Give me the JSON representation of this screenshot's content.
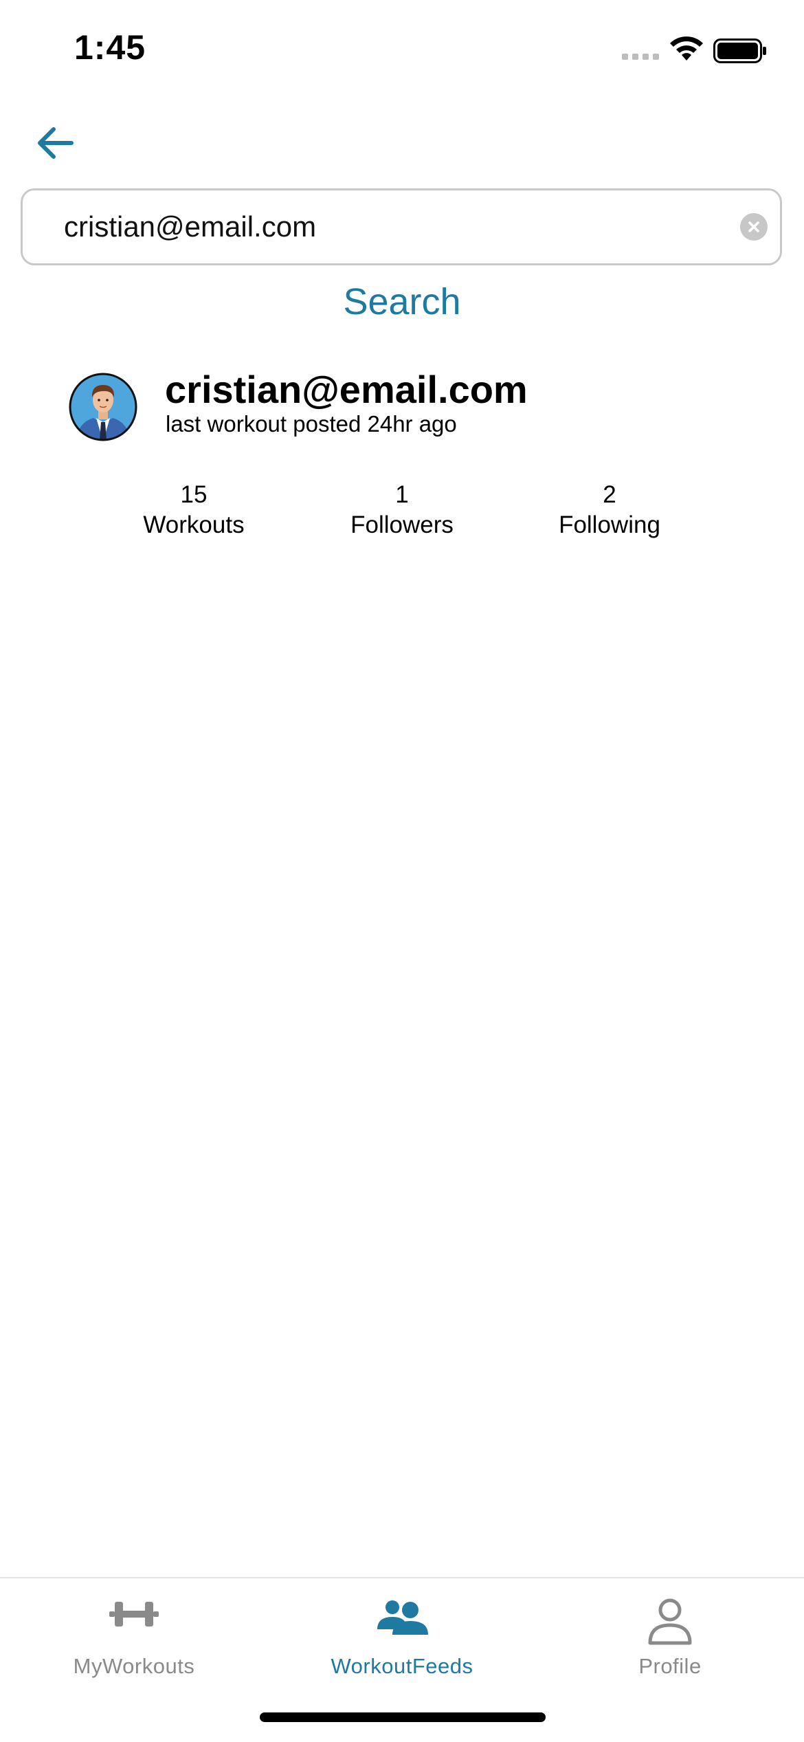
{
  "status_bar": {
    "time": "1:45"
  },
  "search": {
    "value": "cristian@email.com",
    "button_label": "Search"
  },
  "result": {
    "name": "cristian@email.com",
    "subtitle": "last workout posted 24hr ago",
    "stats": [
      {
        "value": "15",
        "label": "Workouts"
      },
      {
        "value": "1",
        "label": "Followers"
      },
      {
        "value": "2",
        "label": "Following"
      }
    ]
  },
  "tabs": [
    {
      "label": "MyWorkouts",
      "icon": "dumbbell-icon",
      "active": false
    },
    {
      "label": "WorkoutFeeds",
      "icon": "users-icon",
      "active": true
    },
    {
      "label": "Profile",
      "icon": "person-icon",
      "active": false
    }
  ],
  "colors": {
    "accent": "#1e7aa0",
    "inactive": "#8a8a8a"
  }
}
